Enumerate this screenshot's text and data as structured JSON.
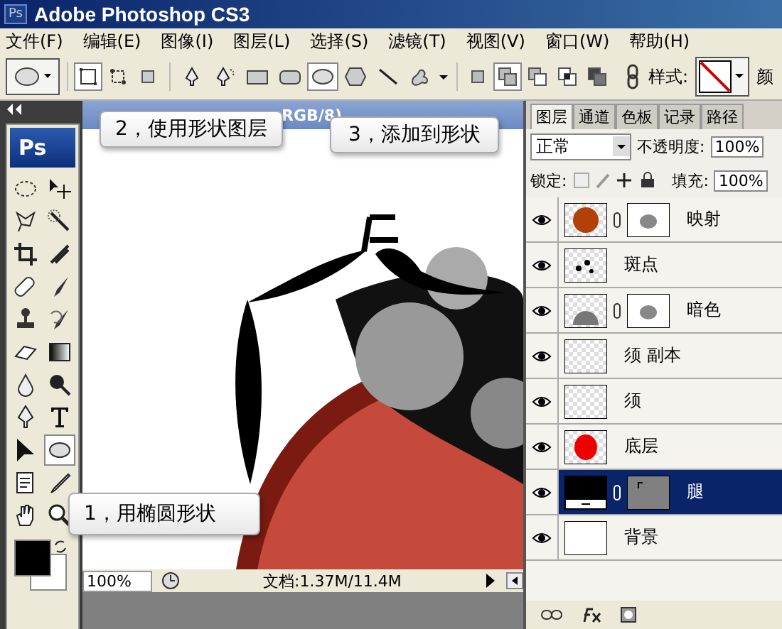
{
  "window": {
    "icon_label": "Ps",
    "title": "Adobe Photoshop CS3"
  },
  "menu": [
    "文件(F)",
    "编辑(E)",
    "图像(I)",
    "图层(L)",
    "选择(S)",
    "滤镜(T)",
    "视图(V)",
    "窗口(W)",
    "帮助(H)"
  ],
  "options_bar": {
    "path_modes": [
      {
        "kind": "shape-layer",
        "selected": true
      },
      {
        "kind": "paths",
        "selected": false
      },
      {
        "kind": "fill-pixels",
        "selected": false
      }
    ],
    "shape_tools": [
      {
        "kind": "pen",
        "selected": false
      },
      {
        "kind": "freeform-pen",
        "selected": false
      },
      {
        "kind": "rectangle",
        "selected": false
      },
      {
        "kind": "rounded-rectangle",
        "selected": false
      },
      {
        "kind": "ellipse",
        "selected": true
      },
      {
        "kind": "polygon",
        "selected": false
      },
      {
        "kind": "line",
        "selected": false
      },
      {
        "kind": "custom-shape",
        "selected": false
      }
    ],
    "combine_modes": [
      {
        "kind": "new",
        "selected": false
      },
      {
        "kind": "add",
        "selected": true
      },
      {
        "kind": "subtract",
        "selected": false
      },
      {
        "kind": "intersect",
        "selected": false
      },
      {
        "kind": "exclude",
        "selected": false
      }
    ],
    "style_label": "样式:",
    "color_label": "颜"
  },
  "toolbox": {
    "logo": "Ps",
    "tools": [
      {
        "kind": "marquee",
        "selected": false
      },
      {
        "kind": "move",
        "selected": false
      },
      {
        "kind": "lasso",
        "selected": false
      },
      {
        "kind": "wand",
        "selected": false
      },
      {
        "kind": "crop",
        "selected": false
      },
      {
        "kind": "slice",
        "selected": false
      },
      {
        "kind": "healing",
        "selected": false
      },
      {
        "kind": "brush",
        "selected": false
      },
      {
        "kind": "stamp",
        "selected": false
      },
      {
        "kind": "history",
        "selected": false
      },
      {
        "kind": "eraser",
        "selected": false
      },
      {
        "kind": "gradient",
        "selected": false
      },
      {
        "kind": "blur",
        "selected": false
      },
      {
        "kind": "dodge",
        "selected": false
      },
      {
        "kind": "pen",
        "selected": false
      },
      {
        "kind": "text",
        "selected": false
      },
      {
        "kind": "select",
        "selected": false
      },
      {
        "kind": "ellipse",
        "selected": true
      },
      {
        "kind": "notes",
        "selected": false
      },
      {
        "kind": "eyedropper",
        "selected": false
      },
      {
        "kind": "hand",
        "selected": false
      },
      {
        "kind": "zoom",
        "selected": false
      }
    ]
  },
  "document": {
    "title": "RGB/8)",
    "zoom": "100%",
    "doc_info": "文档:1.37M/11.4M"
  },
  "callouts": [
    {
      "text": "2，使用形状图层"
    },
    {
      "text": "3，添加到形状"
    },
    {
      "text": "1，用椭圆形状"
    }
  ],
  "layers_panel": {
    "tabs": [
      {
        "label": "图层",
        "selected": true
      },
      {
        "label": "通道",
        "selected": false
      },
      {
        "label": "色板",
        "selected": false
      },
      {
        "label": "记录",
        "selected": false
      },
      {
        "label": "路径",
        "selected": false
      }
    ],
    "blend_mode": "正常",
    "opacity_label": "不透明度:",
    "opacity": "100%",
    "lock_label": "锁定:",
    "fill_label": "填充:",
    "fill": "100%",
    "layers": [
      {
        "name": "映射",
        "kind": "fire",
        "mask": true,
        "visible": true,
        "selected": false
      },
      {
        "name": "斑点",
        "kind": "dots",
        "mask": false,
        "visible": true,
        "selected": false
      },
      {
        "name": "暗色",
        "kind": "dark",
        "mask": true,
        "visible": true,
        "selected": false
      },
      {
        "name": "须 副本",
        "kind": "blank",
        "mask": false,
        "visible": true,
        "selected": false
      },
      {
        "name": "须",
        "kind": "blank",
        "mask": false,
        "visible": true,
        "selected": false
      },
      {
        "name": "底层",
        "kind": "red",
        "mask": false,
        "visible": true,
        "selected": false
      },
      {
        "name": "腿",
        "kind": "shape",
        "mask": true,
        "visible": true,
        "selected": true
      },
      {
        "name": "背景",
        "kind": "white",
        "mask": false,
        "visible": true,
        "selected": false
      }
    ]
  }
}
